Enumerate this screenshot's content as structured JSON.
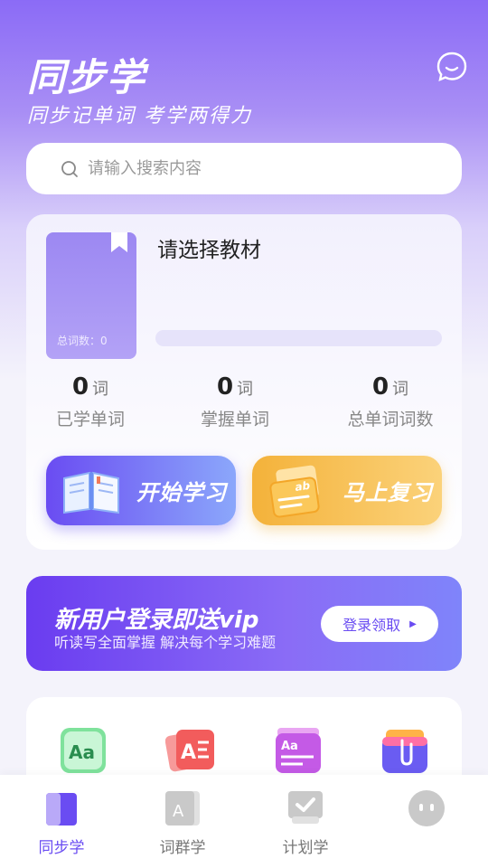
{
  "header": {
    "title": "同步学",
    "subtitle": "同步记单词 考学两得力"
  },
  "search": {
    "placeholder": "请输入搜索内容"
  },
  "book": {
    "select_title": "请选择教材",
    "cover_count": "总词数：0",
    "progress": 0
  },
  "stats": [
    {
      "value": "0",
      "unit": "词",
      "label": "已学单词"
    },
    {
      "value": "0",
      "unit": "词",
      "label": "掌握单词"
    },
    {
      "value": "0",
      "unit": "词",
      "label": "总单词词数"
    }
  ],
  "actions": {
    "study_label": "开始学习",
    "review_label": "马上复习"
  },
  "vip": {
    "title": "新用户登录即送vip",
    "subtitle": "听读写全面掌握 解决每个学习难题",
    "button": "登录领取"
  },
  "tools": [
    {
      "icon": "aa-card-icon"
    },
    {
      "icon": "letter-a-cards-icon"
    },
    {
      "icon": "aa-book-icon"
    },
    {
      "icon": "clip-folder-icon"
    }
  ],
  "tabs": [
    {
      "label": "同步学",
      "icon": "book-icon",
      "active": true
    },
    {
      "label": "词群学",
      "icon": "letter-a-icon",
      "active": false
    },
    {
      "label": "计划学",
      "icon": "checklist-icon",
      "active": false
    },
    {
      "label": "",
      "icon": "face-icon",
      "active": false
    }
  ],
  "colors": {
    "accent": "#6a4cf2",
    "review": "#f4b23a"
  }
}
